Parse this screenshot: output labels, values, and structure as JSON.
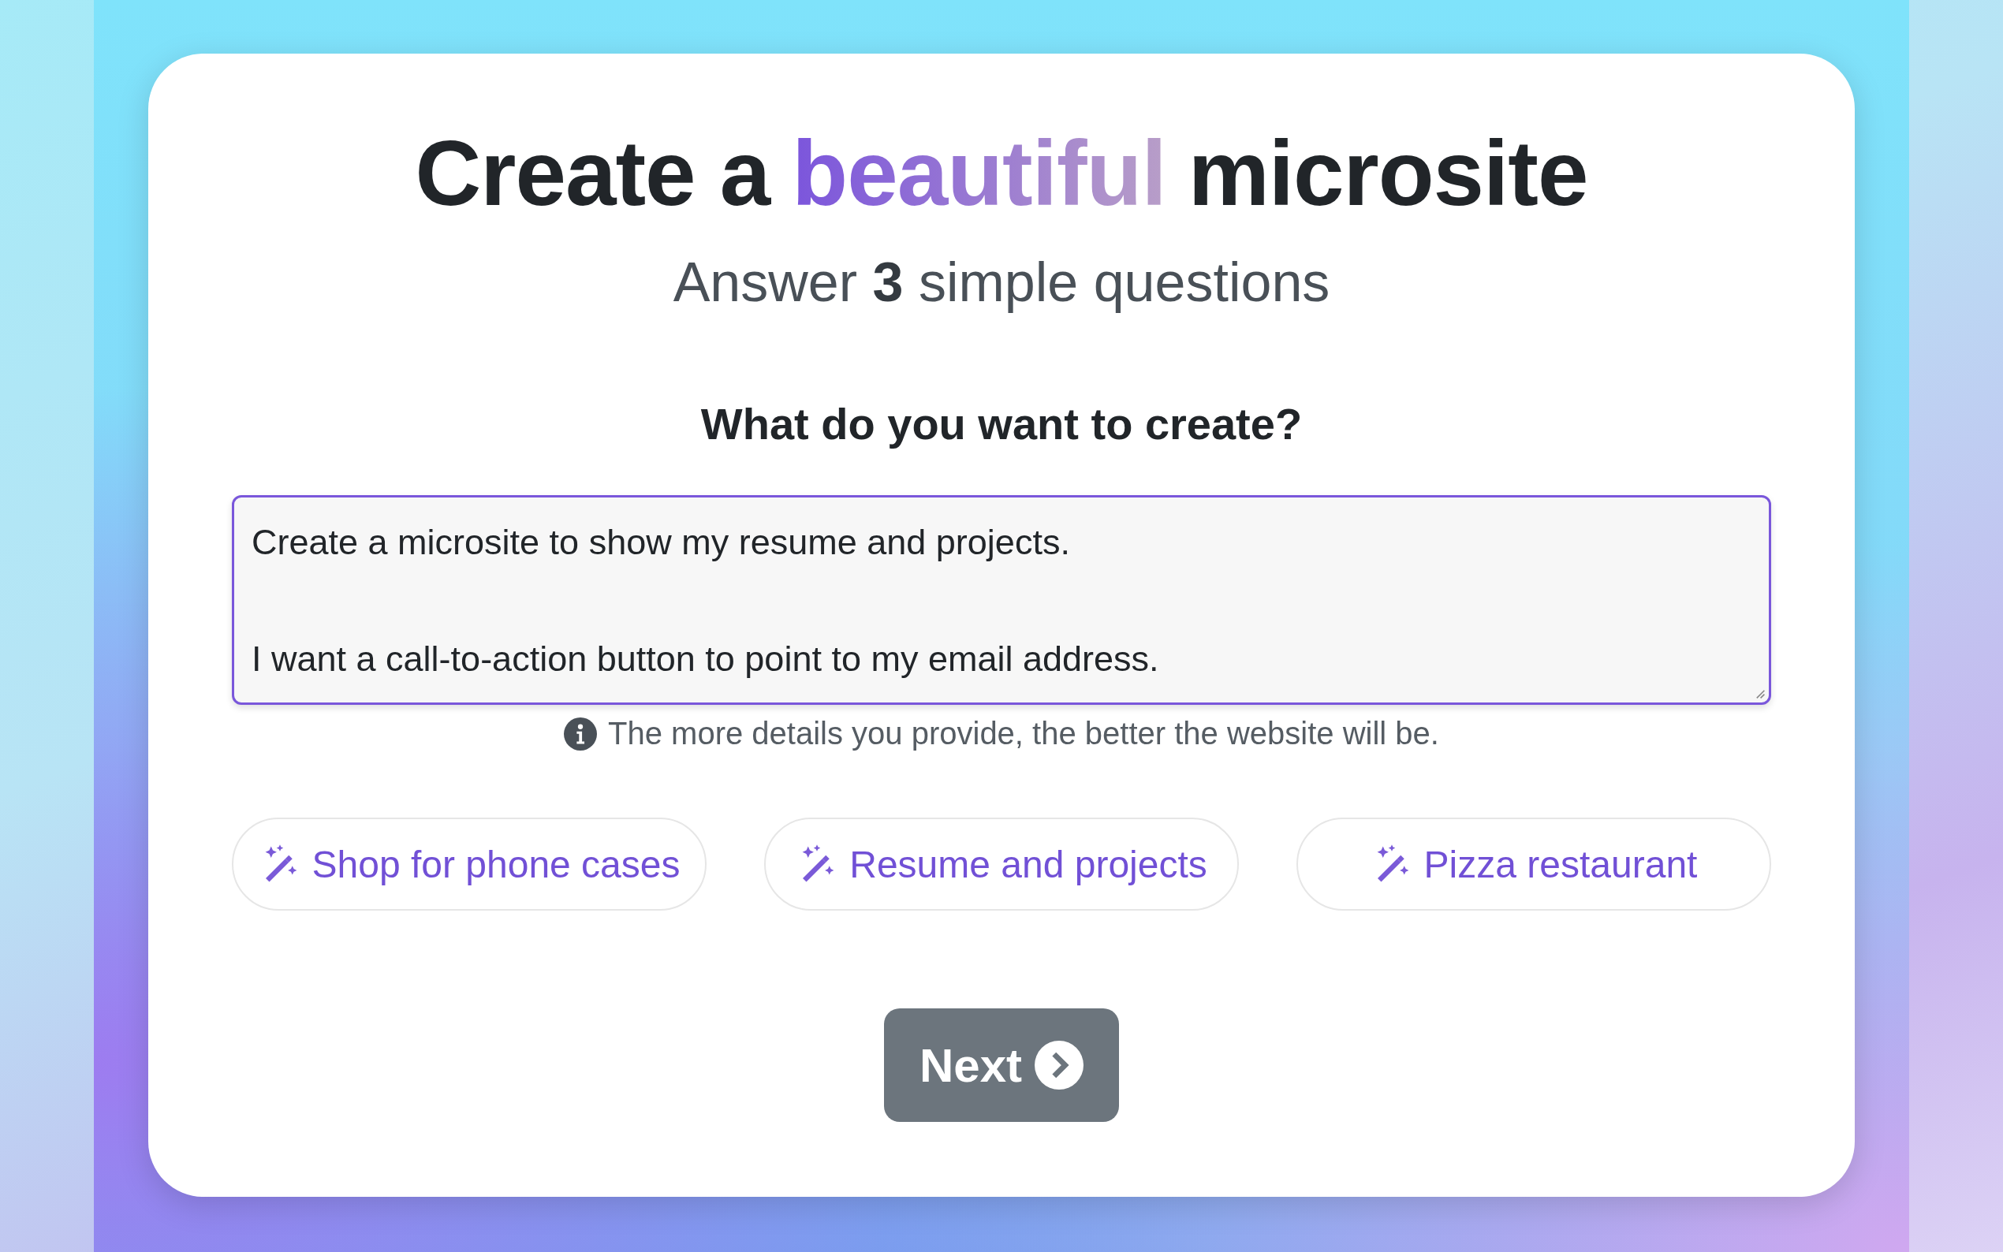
{
  "heading": {
    "before": "Create a",
    "highlight": "beautiful",
    "after": "microsite"
  },
  "subheading": "Answer **3** simple questions",
  "question": "What do you want to create?",
  "answer": {
    "value": "Create a microsite to show my resume and projects.\n\nI want a call-to-action button to point to my email address."
  },
  "hint": "The more details you provide, the better the website will be.",
  "suggestions": [
    "Shop for phone cases",
    "Resume and projects",
    "Pizza restaurant"
  ],
  "next_button": "Next"
}
